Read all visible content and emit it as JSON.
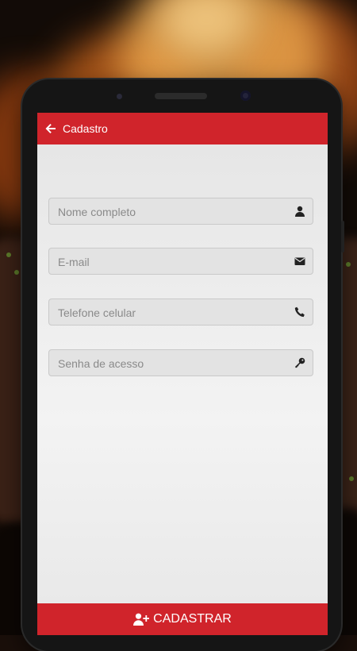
{
  "appbar": {
    "title": "Cadastro",
    "back_icon": "arrow-left-icon"
  },
  "form": {
    "fields": [
      {
        "placeholder": "Nome completo",
        "value": "",
        "icon": "user-icon"
      },
      {
        "placeholder": "E-mail",
        "value": "",
        "icon": "envelope-icon"
      },
      {
        "placeholder": "Telefone celular",
        "value": "",
        "icon": "phone-icon"
      },
      {
        "placeholder": "Senha de acesso",
        "value": "",
        "icon": "key-icon"
      }
    ]
  },
  "submit": {
    "label": "CADASTRAR",
    "icon": "user-plus-icon"
  },
  "colors": {
    "accent": "#d0242b",
    "screen_bg": "#ececec"
  }
}
